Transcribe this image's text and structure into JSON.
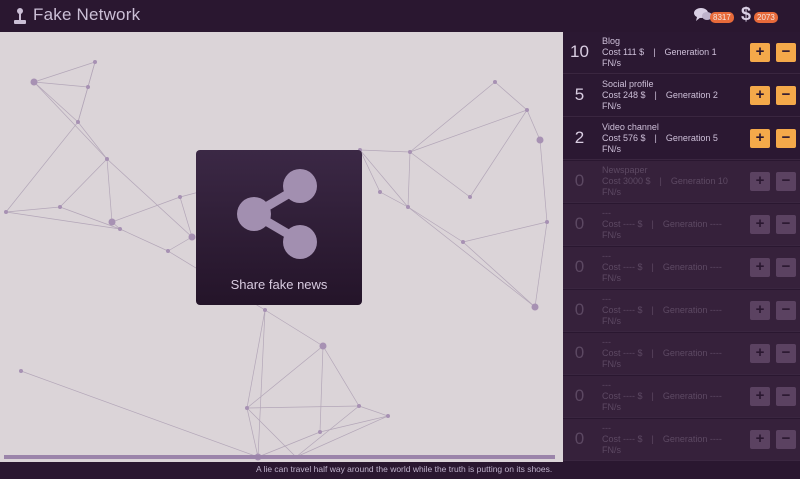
{
  "app": {
    "title": "Fake Network",
    "logo_icon": "joystick-icon"
  },
  "stats": {
    "followers": {
      "icon": "speech-bubbles-icon",
      "value": "8317"
    },
    "money": {
      "icon": "dollar-icon",
      "symbol": "$",
      "value": "2073"
    }
  },
  "canvas": {
    "progress_fraction": 1.0
  },
  "share_button": {
    "label": "Share fake news",
    "icon": "share-icon"
  },
  "footer": {
    "tagline": "A lie can travel half way around the world while the truth is putting on its shoes."
  },
  "units": {
    "rate": "FN/s"
  },
  "colors": {
    "accent": "#f4a94a",
    "badge": "#e76a3a",
    "background": "#2a1730"
  },
  "generators": [
    {
      "count": "10",
      "name": "Blog",
      "cost": "Cost 111 $",
      "generation": "Generation 1",
      "state": "active"
    },
    {
      "count": "5",
      "name": "Social profile",
      "cost": "Cost 248 $",
      "generation": "Generation 2",
      "state": "active"
    },
    {
      "count": "2",
      "name": "Video channel",
      "cost": "Cost 576 $",
      "generation": "Generation 5",
      "state": "active"
    },
    {
      "count": "0",
      "name": "Newspaper",
      "cost": "Cost 3000 $",
      "generation": "Generation 10",
      "state": "locked"
    },
    {
      "count": "0",
      "name": "---",
      "cost": "Cost ---- $",
      "generation": "Generation ----",
      "state": "locked"
    },
    {
      "count": "0",
      "name": "---",
      "cost": "Cost ---- $",
      "generation": "Generation ----",
      "state": "locked"
    },
    {
      "count": "0",
      "name": "---",
      "cost": "Cost ---- $",
      "generation": "Generation ----",
      "state": "locked"
    },
    {
      "count": "0",
      "name": "---",
      "cost": "Cost ---- $",
      "generation": "Generation ----",
      "state": "locked"
    },
    {
      "count": "0",
      "name": "---",
      "cost": "Cost ---- $",
      "generation": "Generation ----",
      "state": "locked"
    },
    {
      "count": "0",
      "name": "---",
      "cost": "Cost ---- $",
      "generation": "Generation ----",
      "state": "locked"
    }
  ]
}
